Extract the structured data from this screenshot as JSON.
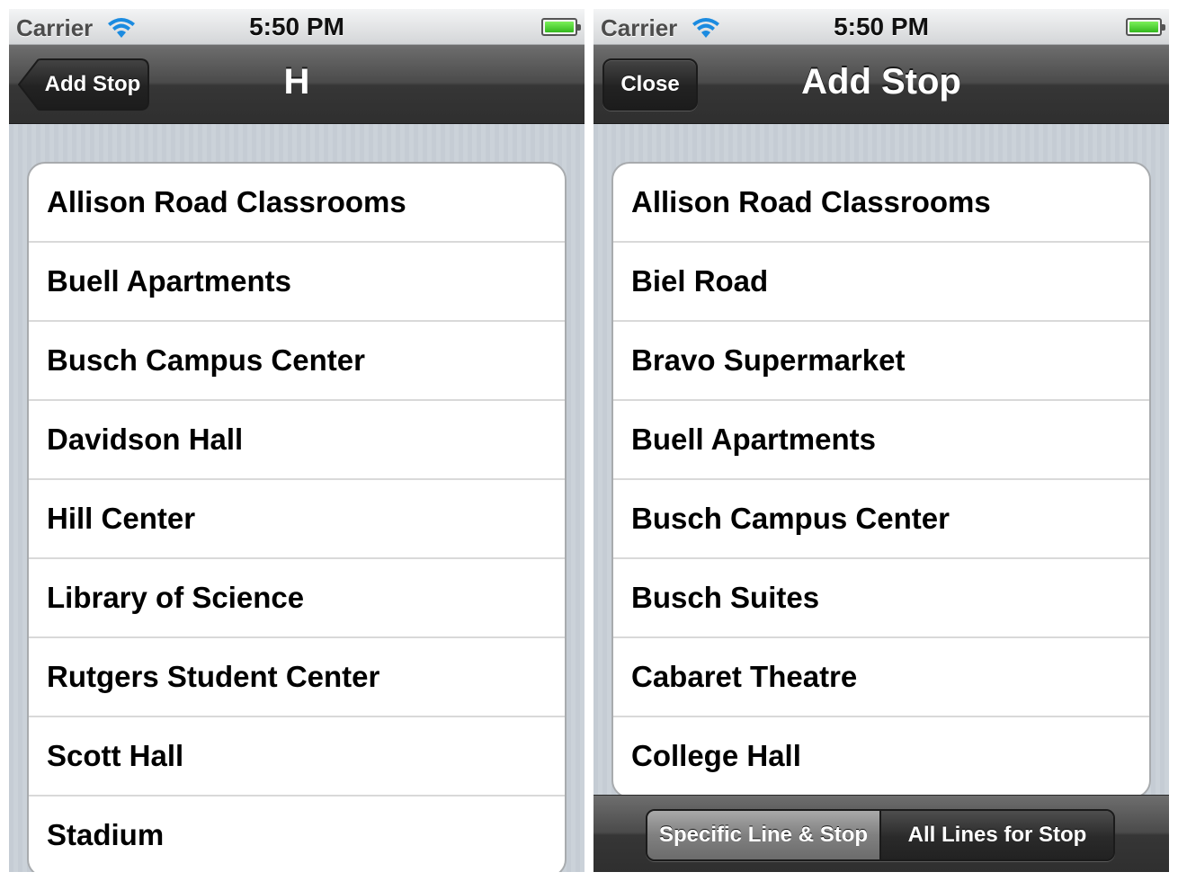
{
  "left_screen": {
    "status_bar": {
      "carrier": "Carrier",
      "time": "5:50 PM",
      "battery_level": 1.0
    },
    "nav_bar": {
      "back_button_label": "Add Stop",
      "title": "H"
    },
    "stops": [
      "Allison Road Classrooms",
      "Buell Apartments",
      "Busch Campus Center",
      "Davidson Hall",
      "Hill Center",
      "Library of Science",
      "Rutgers Student Center",
      "Scott Hall",
      "Stadium"
    ]
  },
  "right_screen": {
    "status_bar": {
      "carrier": "Carrier",
      "time": "5:50 PM",
      "battery_level": 1.0
    },
    "nav_bar": {
      "left_button_label": "Close",
      "title": "Add Stop"
    },
    "stops": [
      "Allison Road Classrooms",
      "Biel Road",
      "Bravo Supermarket",
      "Buell Apartments",
      "Busch Campus Center",
      "Busch Suites",
      "Cabaret Theatre",
      "College Hall"
    ],
    "toolbar": {
      "segments": [
        "Specific Line & Stop",
        "All Lines for Stop"
      ],
      "selected_segment": "Specific Line & Stop"
    }
  },
  "icons": {
    "wifi": "wifi-icon",
    "battery": "battery-icon"
  },
  "colors": {
    "nav_bar": "#3c3c3c",
    "background_stripes": "#c5ccd4",
    "battery_fill": "#4fd134"
  }
}
